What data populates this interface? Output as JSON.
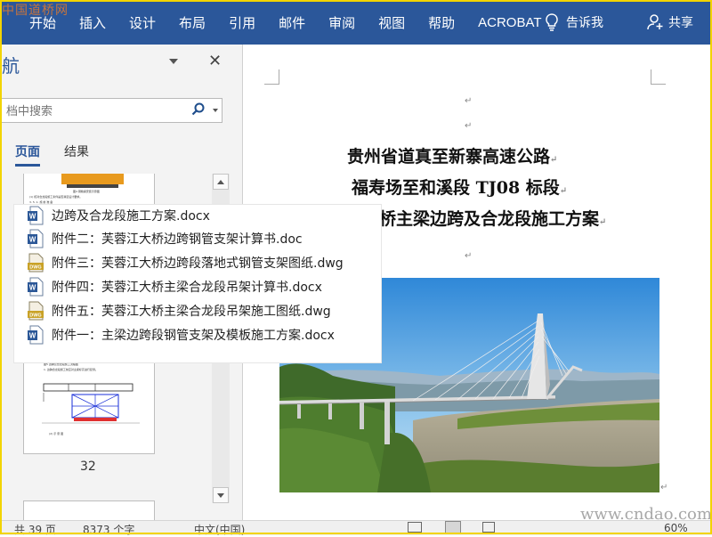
{
  "watermark_logo": "中国道桥网",
  "ribbon": {
    "tabs": [
      "开始",
      "插入",
      "设计",
      "布局",
      "引用",
      "邮件",
      "审阅",
      "视图",
      "帮助",
      "ACROBAT"
    ],
    "tell_me": "告诉我",
    "share": "共享",
    "bg_color": "#2b579a"
  },
  "nav": {
    "title_partial": "航",
    "search_placeholder": "档中搜索",
    "tab_pages": "页面",
    "tab_results": "结果",
    "thumb_page_number": "32",
    "thumb_texts": {
      "caption1": "图4 钢箱梁安装示意图",
      "line1": "(1) 核对合龙段施工条件是否满足设计要求。",
      "line2": "3. 5. 1. 施 前 准 备",
      "line3": "图5 边跨及合龙段施工流程图",
      "line4": "1. 边跨合龙段施工前应对主梁标高进行复测。",
      "caption2": "(2) 示 意 图"
    }
  },
  "file_list": [
    {
      "icon": "word-icon",
      "name": "边跨及合龙段施工方案.docx"
    },
    {
      "icon": "word-icon",
      "name": "附件二：芙蓉江大桥边跨钢管支架计算书.doc"
    },
    {
      "icon": "dwg-icon",
      "name": "附件三：芙蓉江大桥边跨段落地式钢管支架图纸.dwg"
    },
    {
      "icon": "word-icon",
      "name": "附件四：芙蓉江大桥主梁合龙段吊架计算书.docx"
    },
    {
      "icon": "dwg-icon",
      "name": "附件五：芙蓉江大桥主梁合龙段吊架施工图纸.dwg"
    },
    {
      "icon": "word-icon",
      "name": "附件一：主梁边跨段钢管支架及模板施工方案.docx"
    }
  ],
  "document": {
    "title_line1": "贵州省道真至新寨高速公路",
    "title_line2": "福寿场至和溪段 TJ08 标段",
    "title_line3_visible": "桥主梁边跨及合龙段施工方案",
    "para_mark": "↵"
  },
  "status": {
    "page_count": "共 39 页",
    "word_count": "8373 个字",
    "language": "中文(中国)",
    "zoom": "60%"
  },
  "site_watermark": "www.cndao.com"
}
